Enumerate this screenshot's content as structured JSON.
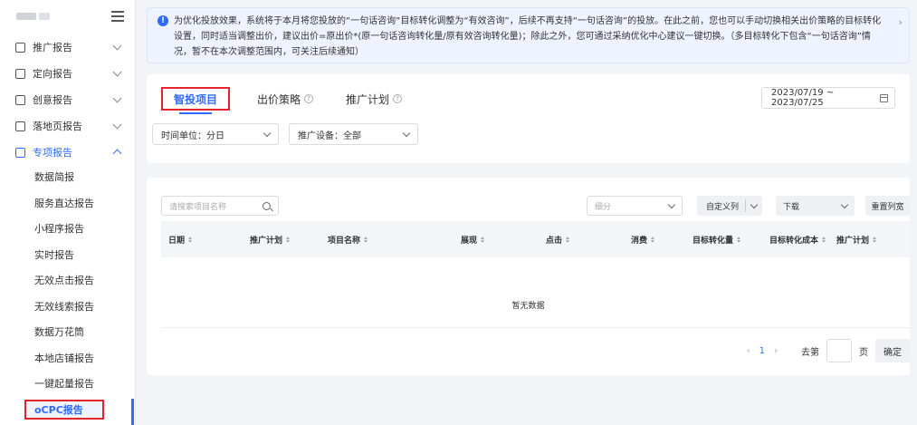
{
  "sidebar": {
    "items": [
      {
        "label": "推广报告"
      },
      {
        "label": "定向报告"
      },
      {
        "label": "创意报告"
      },
      {
        "label": "落地页报告"
      },
      {
        "label": "专项报告"
      }
    ],
    "sub_items": [
      {
        "label": "数据简报"
      },
      {
        "label": "服务直达报告"
      },
      {
        "label": "小程序报告"
      },
      {
        "label": "实时报告"
      },
      {
        "label": "无效点击报告"
      },
      {
        "label": "无效线索报告"
      },
      {
        "label": "数据万花筒"
      },
      {
        "label": "本地店铺报告"
      },
      {
        "label": "一键起量报告"
      },
      {
        "label": "oCPC报告"
      }
    ]
  },
  "notice": {
    "icon": "info-icon",
    "text": "为优化投放效果，系统将于本月将您投放的“一句话咨询”目标转化调整为“有效咨询”，后续不再支持“一句话咨询”的投放。在此之前，您也可以手动切换相关出价策略的目标转化设置，同时适当调整出价，建议出价=原出价*(原一句话咨询转化量/原有效咨询转化量)；除此之外，您可通过采纳优化中心建议一键切换。（多目标转化下包含“一句话咨询”情况，暂不在本次调整范围内，可关注后续通知）",
    "close": "›"
  },
  "tabs": [
    {
      "label": "智投项目"
    },
    {
      "label": "出价策略"
    },
    {
      "label": "推广计划"
    }
  ],
  "date_range": "2023/07/19 ~ 2023/07/25",
  "filters": {
    "time_unit": "时间单位：分日",
    "device": "推广设备：全部"
  },
  "toolbar": {
    "search_placeholder": "请搜索项目名称",
    "segment_placeholder": "细分",
    "custom_columns": "自定义列",
    "download": "下载",
    "reset_columns": "重置列宽"
  },
  "table": {
    "columns": [
      "日期",
      "推广计划",
      "项目名称",
      "展现",
      "点击",
      "消费",
      "目标转化量",
      "目标转化成本",
      "推广计划"
    ],
    "empty_text": "暂无数据"
  },
  "pagination": {
    "prev": "‹",
    "current": "1",
    "next": "›",
    "goto_label": "去第",
    "page_unit": "页",
    "confirm": "确定"
  },
  "colors": {
    "primary": "#2f6bff",
    "highlight_box": "#e5252b"
  }
}
